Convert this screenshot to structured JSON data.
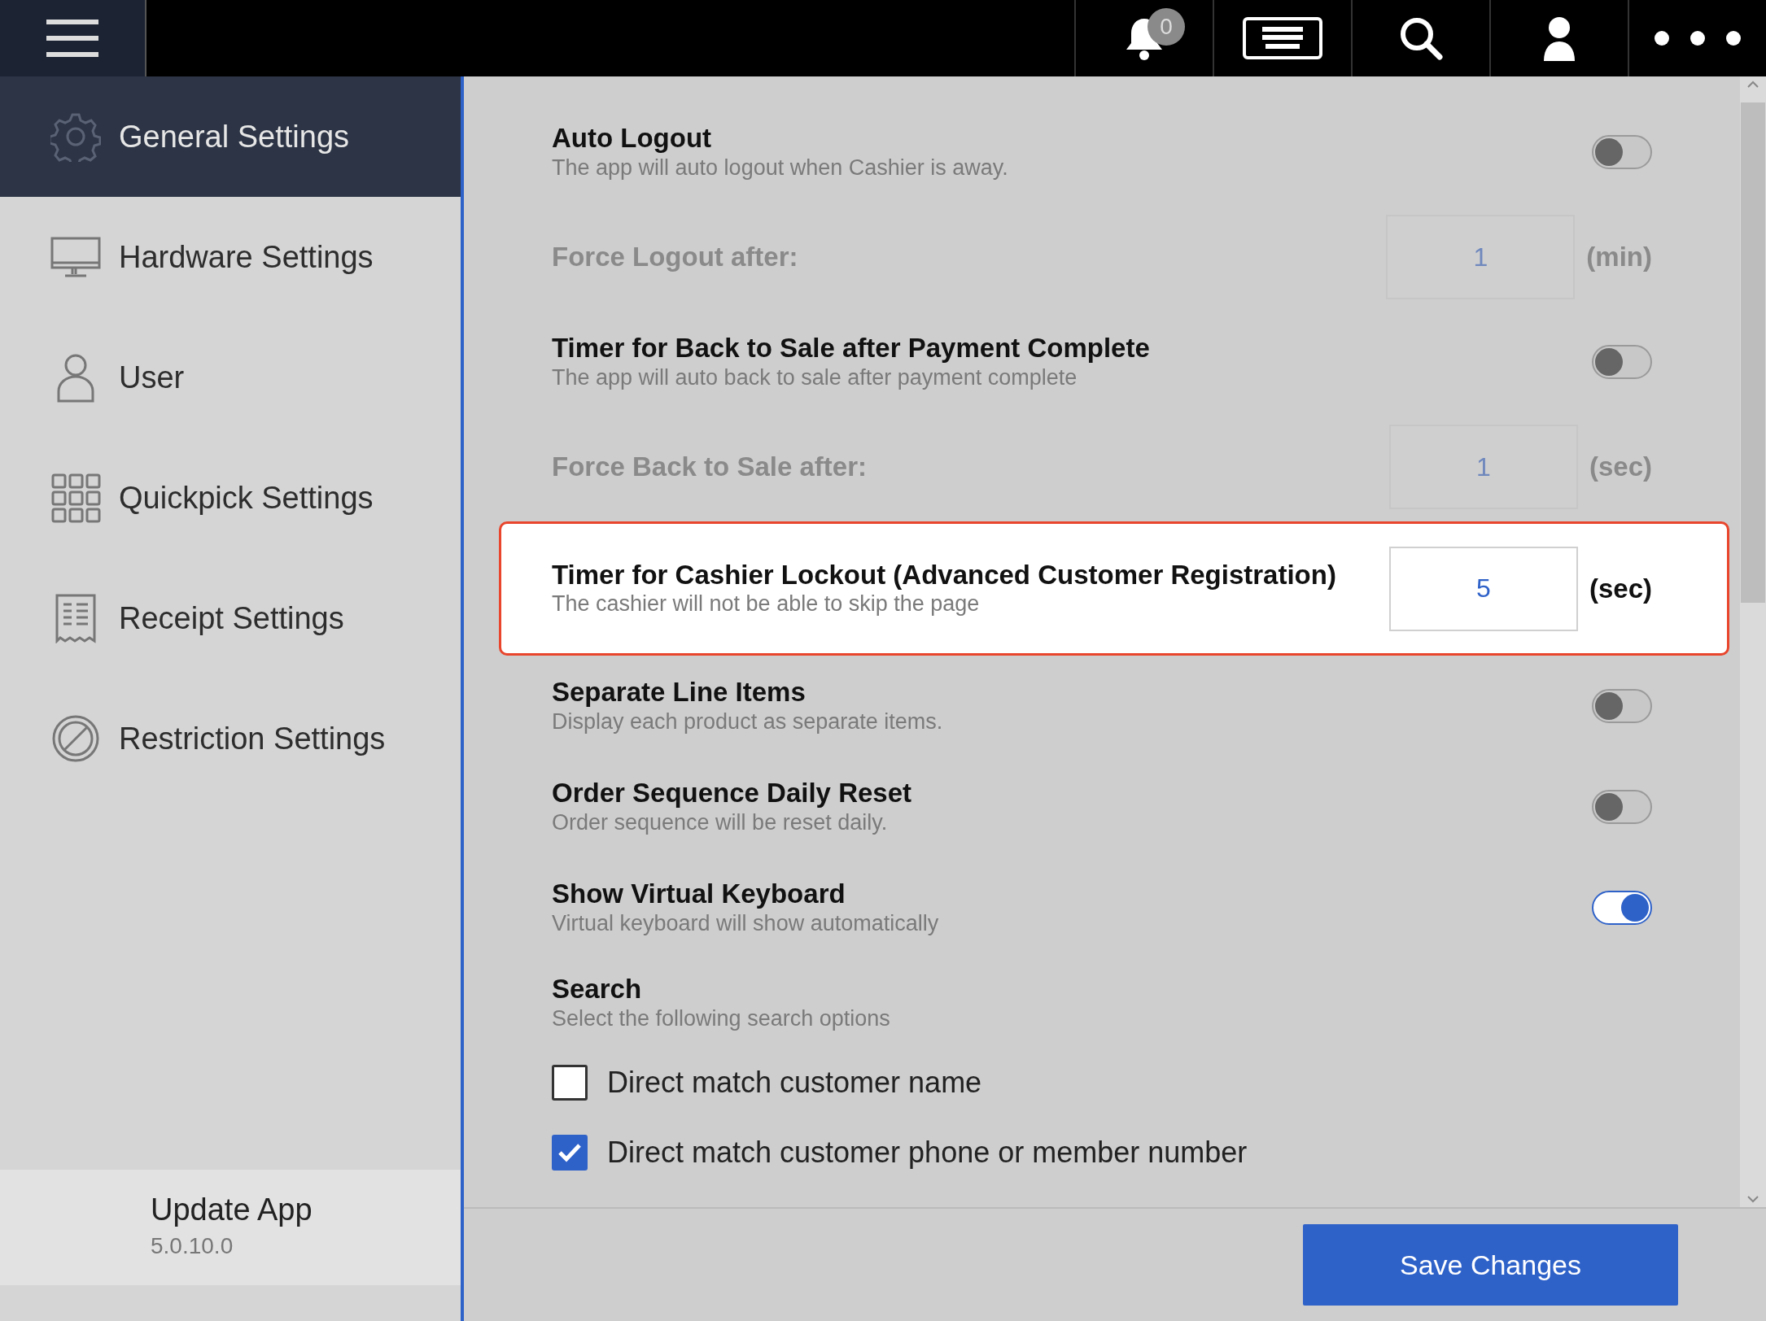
{
  "top_bar": {
    "notification_count": "0"
  },
  "sidebar": {
    "items": [
      {
        "label": "General Settings",
        "selected": true
      },
      {
        "label": "Hardware Settings",
        "selected": false
      },
      {
        "label": "User",
        "selected": false
      },
      {
        "label": "Quickpick Settings",
        "selected": false
      },
      {
        "label": "Receipt Settings",
        "selected": false
      },
      {
        "label": "Restriction Settings",
        "selected": false
      }
    ],
    "update": {
      "label": "Update App",
      "version": "5.0.10.0"
    }
  },
  "settings": [
    {
      "kind": "toggle",
      "title": "Auto Logout",
      "description": "The app will auto logout when Cashier is away.",
      "on": false
    },
    {
      "kind": "number",
      "title": "Force Logout after:",
      "value": "1",
      "unit": "(min)",
      "disabled": true,
      "highlighted": false
    },
    {
      "kind": "toggle",
      "title": "Timer for Back to Sale after Payment Complete",
      "description": "The app will auto back to sale after payment complete",
      "on": false
    },
    {
      "kind": "number",
      "title": "Force Back to Sale after:",
      "value": "1",
      "unit": "(sec)",
      "disabled": true,
      "highlighted": false
    },
    {
      "kind": "number",
      "title": "Timer for Cashier Lockout (Advanced Customer Registration)",
      "description": "The cashier will not be able to skip the page",
      "value": "5",
      "unit": "(sec)",
      "disabled": false,
      "highlighted": true
    },
    {
      "kind": "toggle",
      "title": "Separate Line Items",
      "description": "Display each product as separate items.",
      "on": false
    },
    {
      "kind": "toggle",
      "title": "Order Sequence Daily Reset",
      "description": "Order sequence will be reset daily.",
      "on": false
    },
    {
      "kind": "toggle",
      "title": "Show Virtual Keyboard",
      "description": "Virtual keyboard will show automatically",
      "on": true
    },
    {
      "kind": "options",
      "title": "Search",
      "description": "Select the following search options",
      "options": [
        {
          "label": "Direct match customer name",
          "checked": false
        },
        {
          "label": "Direct match customer phone or member number",
          "checked": true
        }
      ]
    }
  ],
  "save_button": "Save Changes"
}
